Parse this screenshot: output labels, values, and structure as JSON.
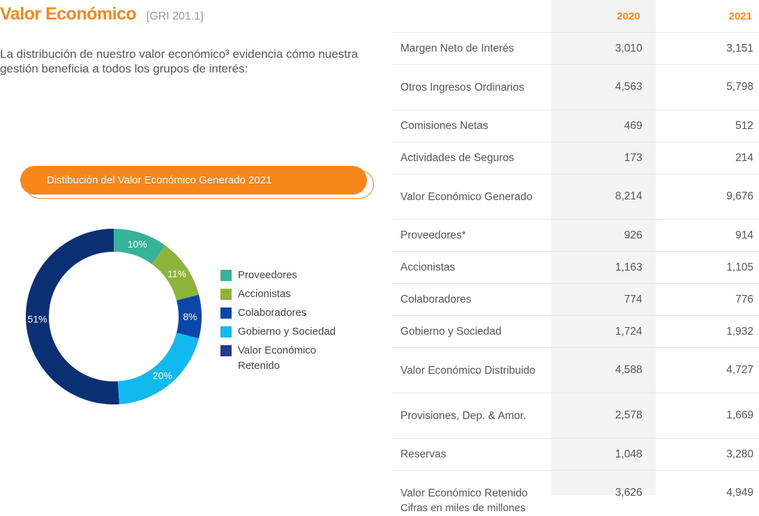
{
  "header": {
    "title": "Valor Económico",
    "gri": "[GRI 201.1]",
    "intro": "La distribución de nuestro valor económico³ evidencia cómo nuestra gestión beneficia a todos los grupos de interés:"
  },
  "banner": {
    "text": "Distibución del Valor Económico Generado 2021"
  },
  "chart_data": {
    "type": "pie",
    "donut": true,
    "categories": [
      "Proveedores",
      "Accionistas",
      "Colaboradores",
      "Gobierno y Sociedad",
      "Valor Económico Retenido"
    ],
    "values": [
      10,
      11,
      8,
      20,
      51
    ],
    "labels": [
      "10%",
      "11%",
      "8%",
      "20%",
      "51%"
    ],
    "colors": [
      "#37b39a",
      "#8cb43a",
      "#0a47a6",
      "#12b9ee",
      "#0a2f73"
    ],
    "legend_colors": [
      "#37b39a",
      "#8cb43a",
      "#0a47a6",
      "#12b9ee",
      "#233a8e"
    ],
    "legend_placement": "right"
  },
  "table": {
    "years": [
      "2020",
      "2021"
    ],
    "rows": [
      {
        "label": "Margen Neto de Interés",
        "v2020": "3,010",
        "v2021": "3,151"
      },
      {
        "label": "Otros Ingresos Ordinarios",
        "v2020": "4,563",
        "v2021": "5,798"
      },
      {
        "label": "Comisiones Netas",
        "v2020": "469",
        "v2021": "512"
      },
      {
        "label": "Actividades de Seguros",
        "v2020": "173",
        "v2021": "214"
      },
      {
        "label": "Valor Económico Generado",
        "v2020": "8,214",
        "v2021": "9,676"
      },
      {
        "label": "Proveedores*",
        "v2020": "926",
        "v2021": "914"
      },
      {
        "label": "Accionistas",
        "v2020": "1,163",
        "v2021": "1,105"
      },
      {
        "label": "Colaboradores",
        "v2020": "774",
        "v2021": "776"
      },
      {
        "label": "Gobierno y Sociedad",
        "v2020": "1,724",
        "v2021": "1,932"
      },
      {
        "label": "Valor Económico Distribuido",
        "v2020": "4,588",
        "v2021": "4,727"
      },
      {
        "label": "Provisiones, Dep. & Amor.",
        "v2020": "2,578",
        "v2021": "1,669"
      },
      {
        "label": "Reservas",
        "v2020": "1,048",
        "v2021": "3,280"
      },
      {
        "label": "Valor Económico Retenido",
        "v2020": "3,626",
        "v2021": "4,949"
      }
    ],
    "footnote": "Cifras en miles de millones"
  }
}
